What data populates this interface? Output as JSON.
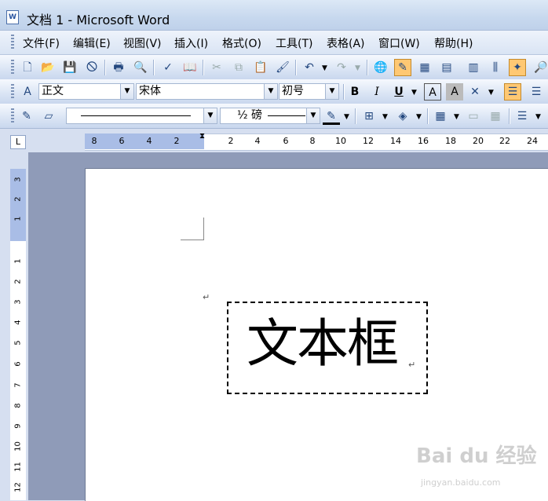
{
  "window": {
    "title": "文档 1 - Microsoft Word",
    "app_icon": "W"
  },
  "menu": [
    "文件(F)",
    "编辑(E)",
    "视图(V)",
    "插入(I)",
    "格式(O)",
    "工具(T)",
    "表格(A)",
    "窗口(W)",
    "帮助(H)"
  ],
  "formatting": {
    "style": "正文",
    "font": "宋体",
    "size": "初号",
    "bold": "B",
    "italic": "I",
    "underline": "U"
  },
  "drawing": {
    "line_weight": "½ 磅"
  },
  "rulers": {
    "horizontal_ticks": [
      "8",
      "6",
      "4",
      "2",
      "2",
      "4",
      "6",
      "8",
      "10",
      "12",
      "14",
      "16",
      "18",
      "20",
      "22",
      "24"
    ],
    "vertical_ticks": [
      "3",
      "2",
      "1",
      "1",
      "2",
      "3",
      "4",
      "5",
      "6",
      "7",
      "8",
      "9",
      "10",
      "11",
      "12"
    ],
    "corner": "L"
  },
  "document": {
    "para_mark": "↵",
    "textbox_text": "文本框"
  },
  "watermark": {
    "brand": "Bai du 经验",
    "url": "jingyan.baidu.com"
  },
  "colors": {
    "active_button": "#ffc873",
    "ruler_margin": "#a9bde6",
    "doc_background": "#8f9bb8"
  }
}
